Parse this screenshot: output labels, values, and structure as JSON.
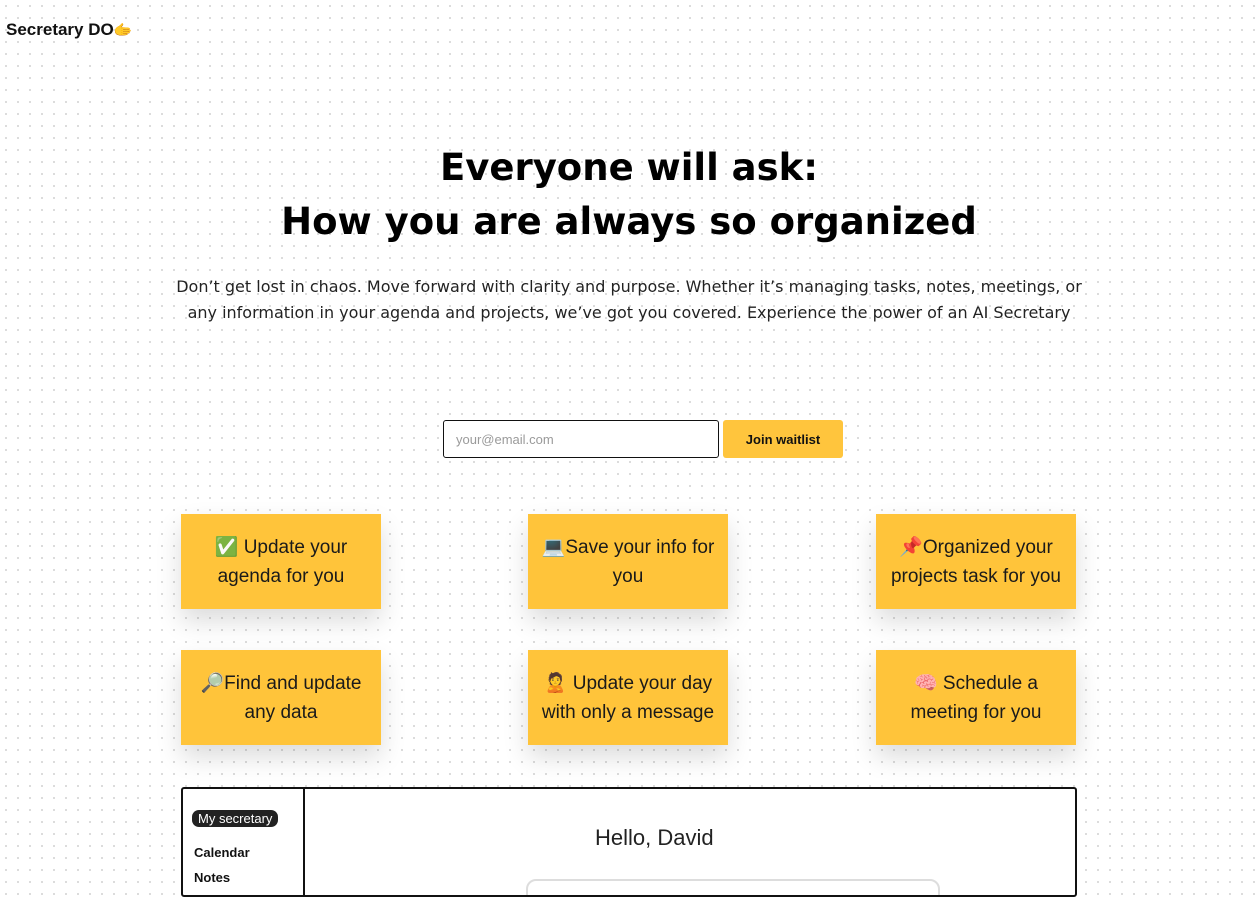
{
  "brand": {
    "name": "Secretary DO",
    "emoji": "🫱"
  },
  "hero": {
    "title_line1": "Everyone will ask:",
    "title_line2": "How you are always so organized",
    "subtitle": "Don’t get lost in chaos. Move forward with clarity and purpose. Whether it’s managing tasks, notes, meetings, or any information in your agenda and projects, we’ve got you covered. Experience the power of an AI Secretary"
  },
  "waitlist": {
    "email_placeholder": "your@email.com",
    "button_label": "Join waitlist"
  },
  "features": [
    {
      "icon": "check-mark-icon",
      "text": "✅ Update your agenda for you"
    },
    {
      "icon": "laptop-icon",
      "text": "💻Save your info for you"
    },
    {
      "icon": "pushpin-icon",
      "text": "📌Organized your projects task for you"
    },
    {
      "icon": "magnifier-icon",
      "text": "🔎Find and  update any data"
    },
    {
      "icon": "person-icon",
      "text": "🙎 Update your day with only a message"
    },
    {
      "icon": "brain-icon",
      "text": "🧠 Schedule a meeting for you"
    }
  ],
  "preview": {
    "sidebar_title": "My secretary",
    "sidebar_items": [
      "Calendar",
      "Notes"
    ],
    "greeting": "Hello, David"
  },
  "colors": {
    "accent": "#ffc43a",
    "text": "#111111",
    "background": "#ffffff"
  }
}
